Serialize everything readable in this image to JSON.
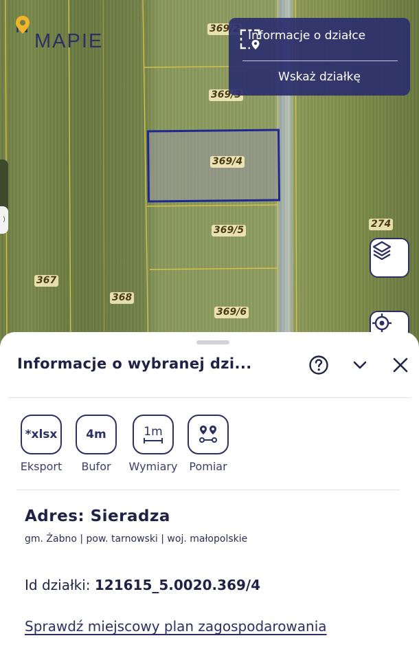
{
  "logo": {
    "part1": "N",
    "part2": "MAPIE"
  },
  "info_panel": {
    "parcel_info_label": "Informacje o działce",
    "select_parcel_label": "Wskaż działkę"
  },
  "map": {
    "parcels": [
      {
        "label": "369/2"
      },
      {
        "label": "369/3"
      },
      {
        "label": "369/4"
      },
      {
        "label": "369/5"
      },
      {
        "label": "369/6"
      },
      {
        "label": "367"
      },
      {
        "label": "368"
      },
      {
        "label": "274"
      }
    ],
    "selected_parcel": "369/4",
    "highlight_color": "#1e2690",
    "edge_tab_text": ")"
  },
  "sheet": {
    "title": "Informacje o wybranej dzi...",
    "tools": [
      {
        "text": "*xlsx",
        "label": "Eksport"
      },
      {
        "text": "4m",
        "label": "Bufor"
      },
      {
        "text": "1m",
        "label": "Wymiary"
      },
      {
        "icon": "measure-pins-icon",
        "label": "Pomiar"
      }
    ],
    "address_title": "Adres: Sieradza",
    "address_sub": "gm. Żabno | pow. tarnowski | woj. małopolskie",
    "parcel_id_label": "Id działki: ",
    "parcel_id_value": "121615_5.0020.369/4",
    "plan_link": "Sprawdź miejscowy plan zagospodarowania"
  },
  "colors": {
    "primary": "#2b2f66",
    "panel": "#2b2f6e",
    "logo_accent": "#f0b429"
  }
}
